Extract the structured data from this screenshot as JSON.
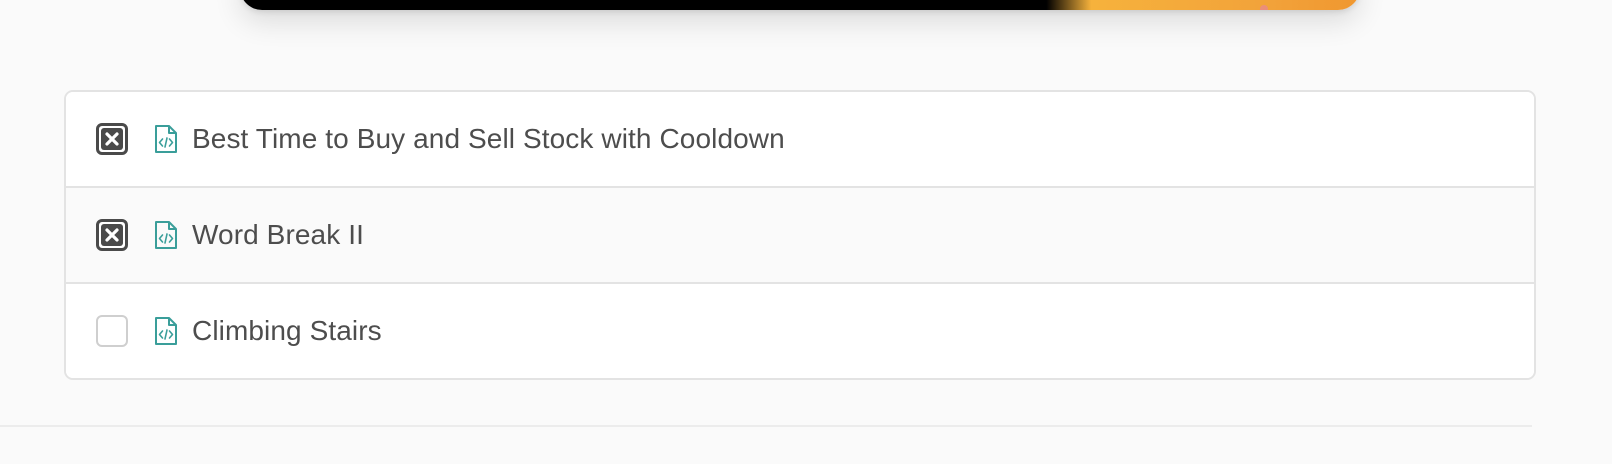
{
  "tasks": [
    {
      "title": "Best Time to Buy and Sell Stock with Cooldown",
      "checked": true,
      "icon": "code-file-icon"
    },
    {
      "title": "Word Break II",
      "checked": true,
      "icon": "code-file-icon"
    },
    {
      "title": "Climbing Stairs",
      "checked": false,
      "icon": "code-file-icon"
    }
  ],
  "colors": {
    "text": "#4d4d4d",
    "icon_teal": "#3a9e9a",
    "checkbox_checked": "#4a4a4a",
    "checkbox_unchecked": "#cfcfcf",
    "border": "#e3e3e3"
  }
}
